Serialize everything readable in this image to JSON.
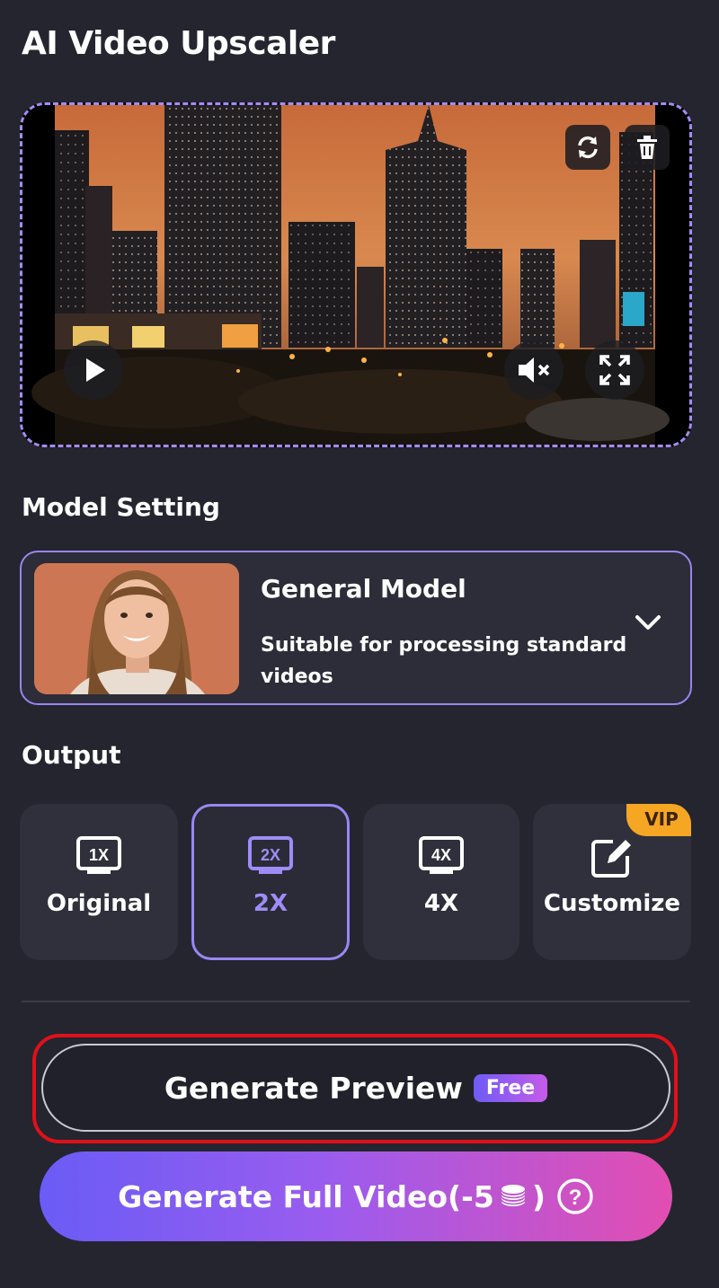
{
  "header": {
    "title": "AI Video Upscaler"
  },
  "video": {
    "controls": [
      "refresh-icon",
      "trash-icon",
      "play-icon",
      "mute-icon",
      "fullscreen-icon"
    ]
  },
  "model_setting": {
    "label": "Model Setting",
    "selected": {
      "name": "General Model",
      "description": "Suitable for processing standard videos"
    }
  },
  "output": {
    "label": "Output",
    "options": [
      {
        "label": "Original",
        "icon": "1X",
        "selected": false
      },
      {
        "label": "2X",
        "icon": "2X",
        "selected": true
      },
      {
        "label": "4X",
        "icon": "4X",
        "selected": false
      },
      {
        "label": "Customize",
        "icon": "edit-icon",
        "badge": "VIP",
        "selected": false
      }
    ]
  },
  "actions": {
    "preview_label": "Generate Preview",
    "preview_badge": "Free",
    "full_prefix": "Generate Full Video(-5",
    "full_suffix": ")"
  },
  "colors": {
    "accent": "#9a86f4",
    "vip": "#f5a623",
    "highlight": "#e0101a",
    "gradient_start": "#6a5cf5",
    "gradient_end": "#e24eb2"
  }
}
